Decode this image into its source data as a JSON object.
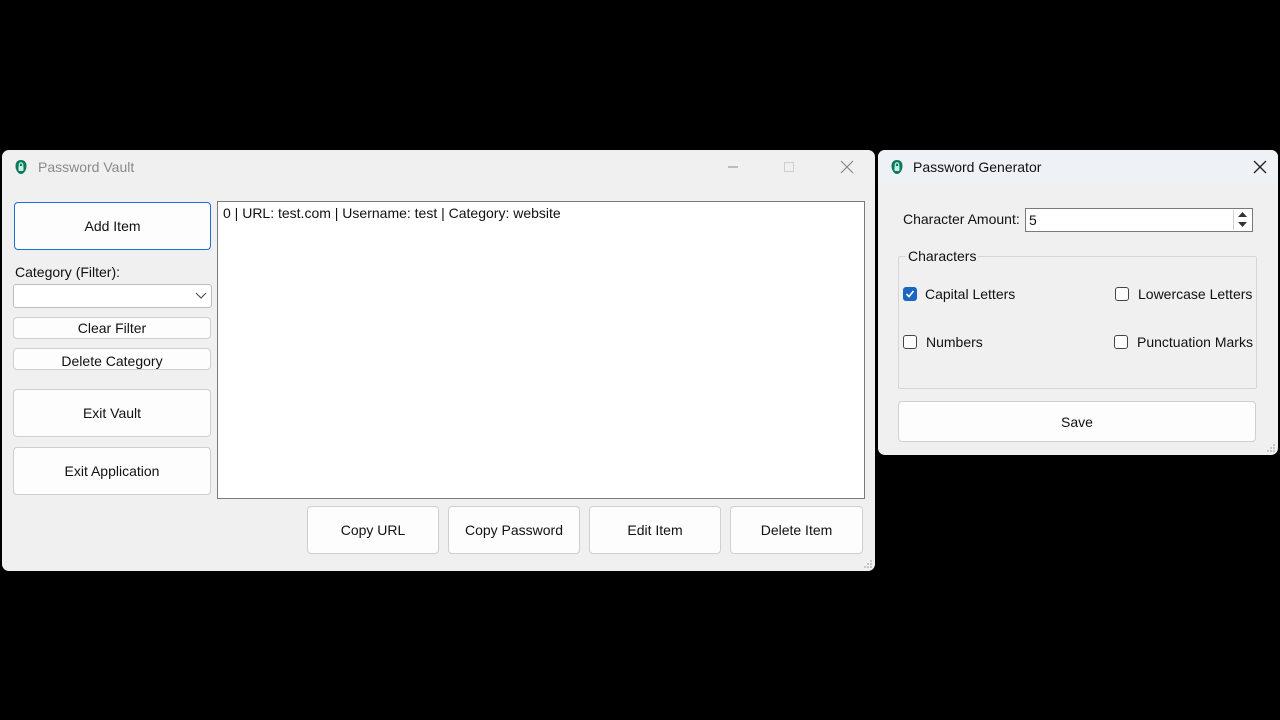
{
  "vault": {
    "title": "Password Vault",
    "buttons": {
      "add_item": "Add Item",
      "clear_filter": "Clear Filter",
      "delete_category": "Delete Category",
      "exit_vault": "Exit Vault",
      "exit_application": "Exit Application",
      "copy_url": "Copy URL",
      "copy_password": "Copy Password",
      "edit_item": "Edit Item",
      "delete_item": "Delete Item"
    },
    "category_filter_label": "Category (Filter):",
    "category_filter_value": "",
    "items": [
      "0 | URL: test.com | Username: test | Category: website"
    ]
  },
  "generator": {
    "title": "Password Generator",
    "character_amount_label": "Character Amount:",
    "character_amount_value": "5",
    "characters_group_label": "Characters",
    "options": {
      "capital_letters": {
        "label": "Capital Letters",
        "checked": true
      },
      "lowercase_letters": {
        "label": "Lowercase Letters",
        "checked": false
      },
      "numbers": {
        "label": "Numbers",
        "checked": false
      },
      "punctuation_marks": {
        "label": "Punctuation Marks",
        "checked": false
      }
    },
    "save_label": "Save"
  },
  "colors": {
    "accent": "#1867c0",
    "window_bg": "#f0f0f0",
    "desktop_bg": "#000000"
  }
}
